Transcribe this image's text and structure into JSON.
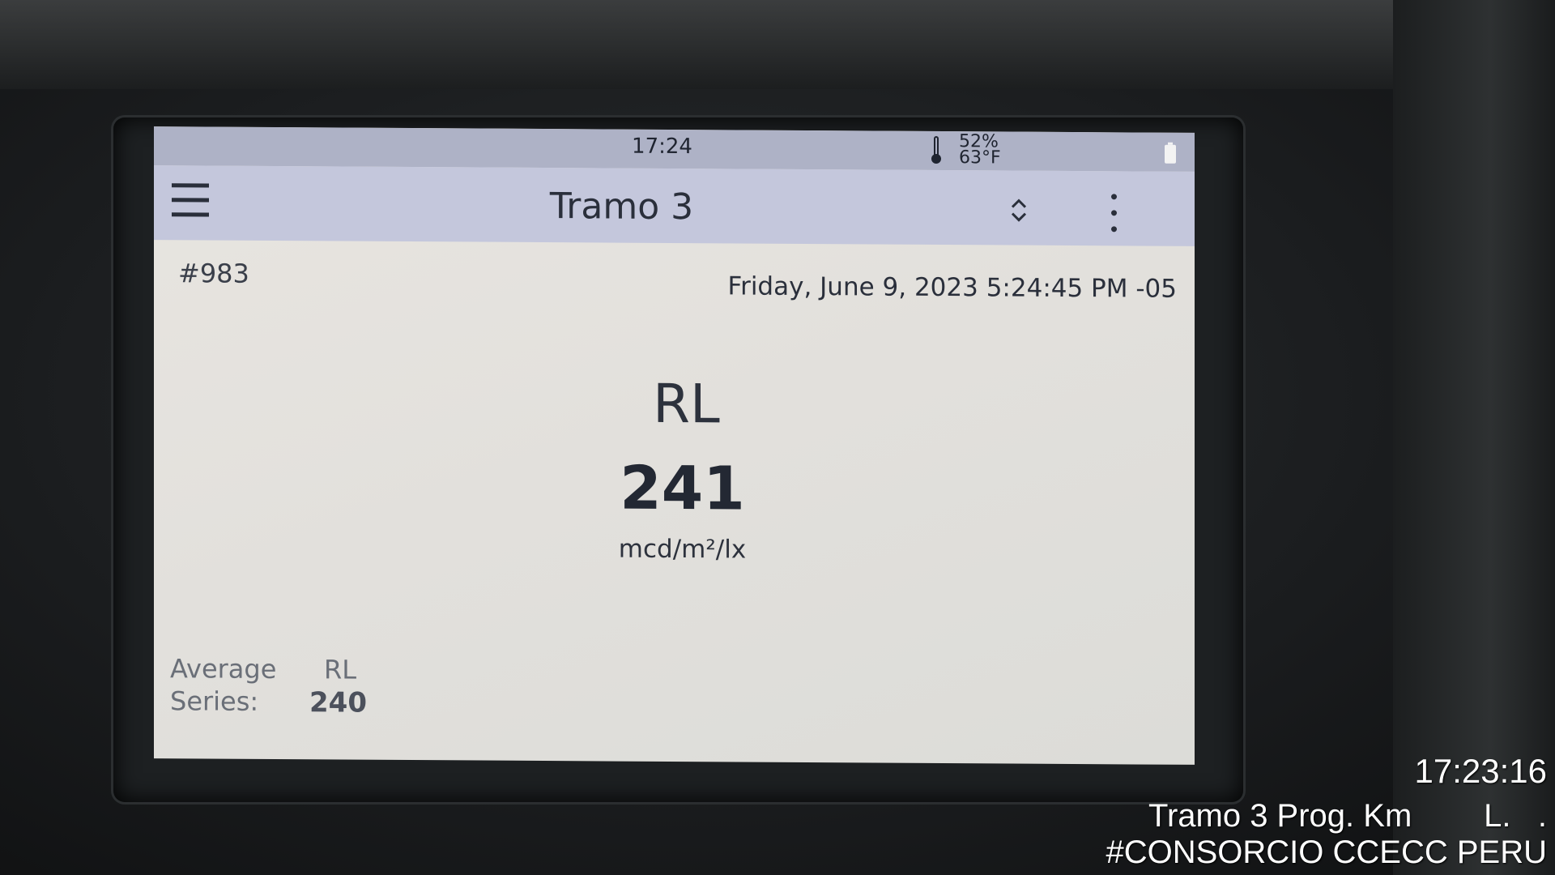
{
  "status_bar": {
    "time": "17:24",
    "humidity": "52%",
    "temperature": "63°F"
  },
  "toolbar": {
    "title": "Tramo 3"
  },
  "measurement": {
    "record_number": "#983",
    "datetime": "Friday, June 9, 2023 5:24:45 PM -05",
    "label": "RL",
    "value": "241",
    "unit": "mcd/m²/lx"
  },
  "average": {
    "label_line1": "Average",
    "label_line2": "Series:",
    "metric": "RL",
    "value": "240"
  },
  "photo_overlay": {
    "time": "17:23:16",
    "location": "Tramo 3 Prog. Km        L.   .",
    "organization": "#CONSORCIO CCECC PERU"
  }
}
